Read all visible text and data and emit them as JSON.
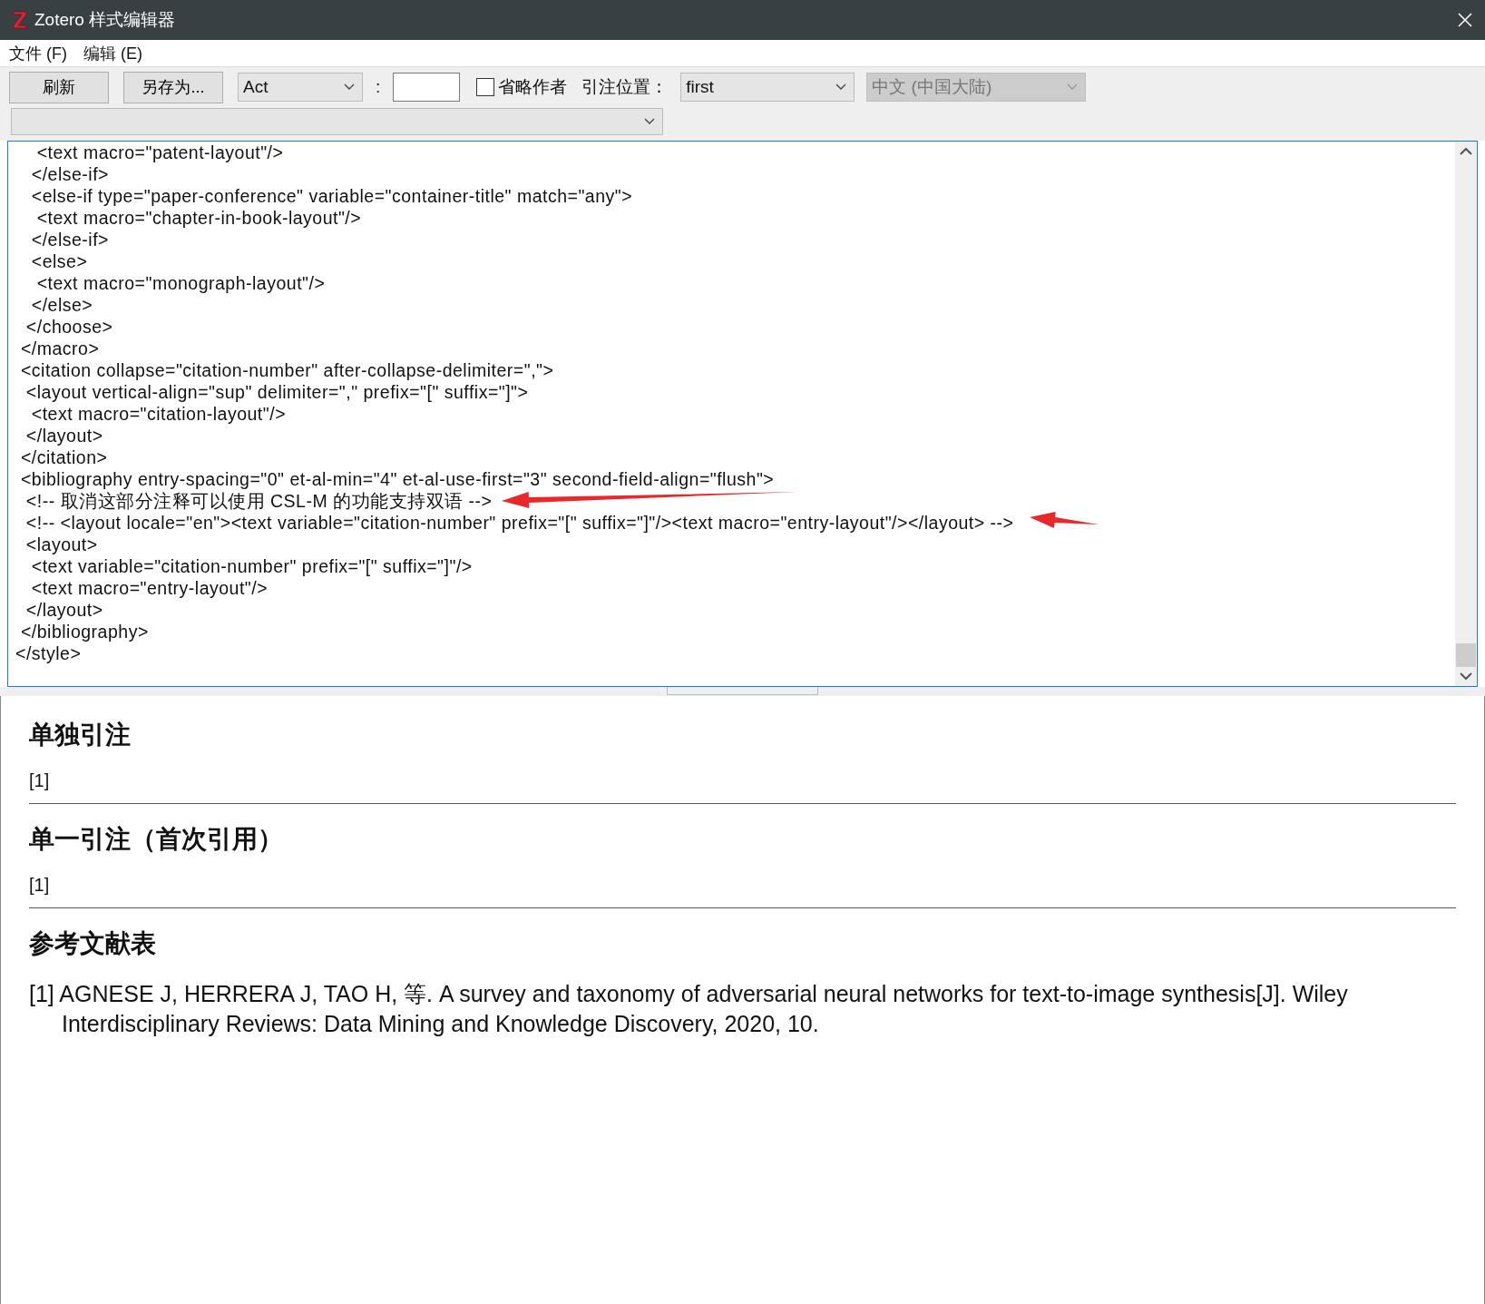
{
  "window": {
    "title": "Zotero 样式编辑器"
  },
  "menu": [
    "文件 (F)",
    "编辑 (E)"
  ],
  "toolbar": {
    "refresh_button": "刷新",
    "save_as_button": "另存为...",
    "style_select": {
      "value": "Act"
    },
    "colon": ":",
    "suppress_author": {
      "label": "省略作者",
      "checked": false
    },
    "position_label": "引注位置：",
    "position_select": {
      "value": "first"
    },
    "locale_select": {
      "value": "中文 (中国大陆)",
      "disabled": true
    }
  },
  "editor": {
    "lines": [
      "    <text macro=\"patent-layout\"/>",
      "   </else-if>",
      "   <else-if type=\"paper-conference\" variable=\"container-title\" match=\"any\">",
      "    <text macro=\"chapter-in-book-layout\"/>",
      "   </else-if>",
      "   <else>",
      "    <text macro=\"monograph-layout\"/>",
      "   </else>",
      "  </choose>",
      " </macro>",
      " <citation collapse=\"citation-number\" after-collapse-delimiter=\",\">",
      "  <layout vertical-align=\"sup\" delimiter=\",\" prefix=\"[\" suffix=\"]\">",
      "   <text macro=\"citation-layout\"/>",
      "  </layout>",
      " </citation>",
      " <bibliography entry-spacing=\"0\" et-al-min=\"4\" et-al-use-first=\"3\" second-field-align=\"flush\">",
      "  <!-- 取消这部分注释可以使用 CSL-M 的功能支持双语 -->",
      "  <!-- <layout locale=\"en\"><text variable=\"citation-number\" prefix=\"[\" suffix=\"]\"/><text macro=\"entry-layout\"/></layout> -->",
      "  <layout>",
      "   <text variable=\"citation-number\" prefix=\"[\" suffix=\"]\"/>",
      "   <text macro=\"entry-layout\"/>",
      "  </layout>",
      " </bibliography>",
      "</style>"
    ]
  },
  "preview": {
    "sections": [
      {
        "heading": "单独引注",
        "kind": "citation",
        "entries": [
          "[1]"
        ]
      },
      {
        "heading": "单一引注（首次引用）",
        "kind": "citation",
        "entries": [
          "[1]"
        ]
      },
      {
        "heading": "参考文献表",
        "kind": "bibliography",
        "entries": [
          "[1] AGNESE J, HERRERA J, TAO H, 等. A survey and taxonomy of adversarial neural networks for text-to-image synthesis[J]. Wiley Interdisciplinary Reviews: Data Mining and Knowledge Discovery, 2020, 10."
        ]
      }
    ]
  }
}
